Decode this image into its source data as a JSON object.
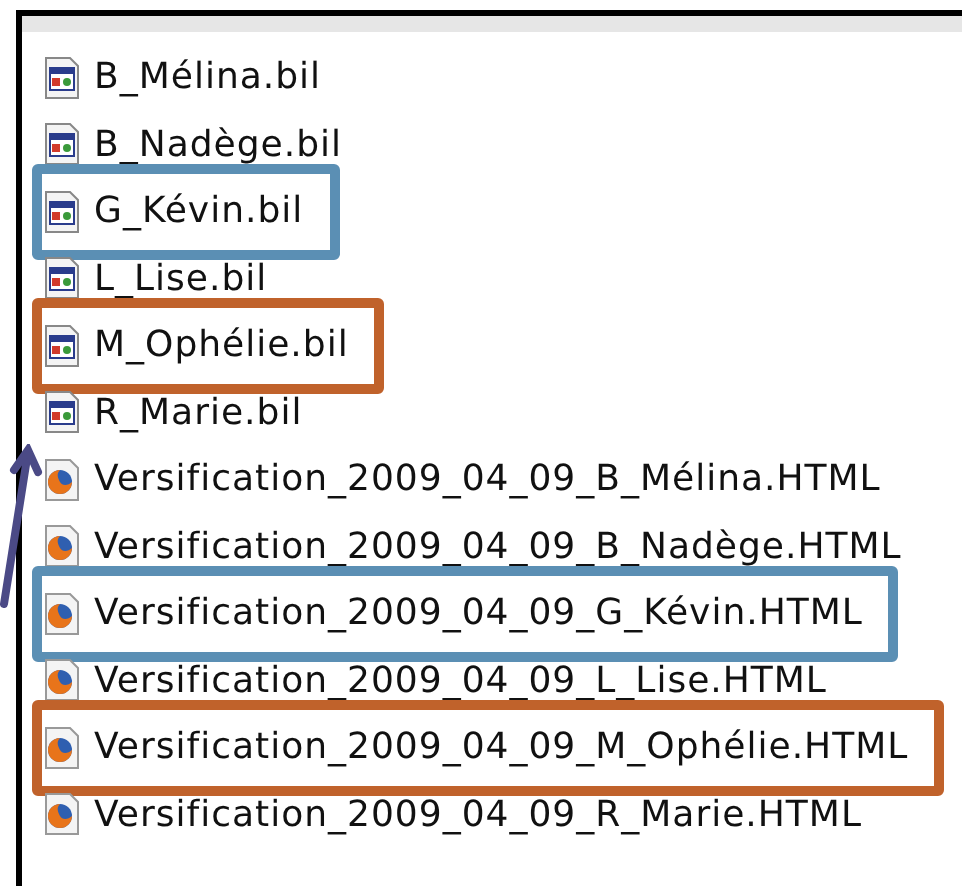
{
  "files": [
    {
      "name": "B_Mélina.bil",
      "kind": "bil"
    },
    {
      "name": "B_Nadège.bil",
      "kind": "bil"
    },
    {
      "name": "G_Kévin.bil",
      "kind": "bil",
      "color": "#5b8fb4"
    },
    {
      "name": "L_Lise.bil",
      "kind": "bil"
    },
    {
      "name": "M_Ophélie.bil",
      "kind": "bil",
      "color": "#c0622b"
    },
    {
      "name": "R_Marie.bil",
      "kind": "bil"
    },
    {
      "name": "Versification_2009_04_09_B_Mélina.HTML",
      "kind": "html"
    },
    {
      "name": "Versification_2009_04_09_B_Nadège.HTML",
      "kind": "html"
    },
    {
      "name": "Versification_2009_04_09_G_Kévin.HTML",
      "kind": "html",
      "color": "#5b8fb4"
    },
    {
      "name": "Versification_2009_04_09_L_Lise.HTML",
      "kind": "html"
    },
    {
      "name": "Versification_2009_04_09_M_Ophélie.HTML",
      "kind": "html",
      "color": "#c0622b"
    },
    {
      "name": "Versification_2009_04_09_R_Marie.HTML",
      "kind": "html"
    }
  ]
}
